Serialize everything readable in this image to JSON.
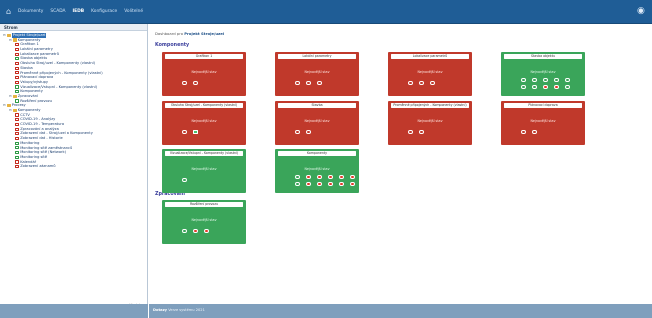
{
  "topbar": {
    "nav": [
      "Dokumenty",
      "SCADA",
      "IEDB",
      "Konfigurace",
      "Volitelné"
    ],
    "active_index": 2,
    "brand_color": "#1f5d96"
  },
  "left": {
    "title": "Strom",
    "tree": [
      {
        "label": "Projekt Stroje/uzel",
        "level": 0,
        "icon": "folder",
        "toggle": "-",
        "sel": true
      },
      {
        "label": "Komponenty",
        "level": 1,
        "icon": "folder",
        "toggle": "-"
      },
      {
        "label": "Grafikon 1",
        "level": 2,
        "icon": "red"
      },
      {
        "label": "Lokální parametry",
        "level": 2,
        "icon": "red"
      },
      {
        "label": "Lokalizace parametrů",
        "level": 2,
        "icon": "red"
      },
      {
        "label": "Stavba objektu",
        "level": 2,
        "icon": "green"
      },
      {
        "label": "Obsluha Stroj/uzel - Komponenty (vlastní)",
        "level": 2,
        "icon": "red"
      },
      {
        "label": "Stavba",
        "level": 2,
        "icon": "red"
      },
      {
        "label": "Proměnné připojených - Komponenty (vlastní)",
        "level": 2,
        "icon": "red"
      },
      {
        "label": "Plánovací doprava",
        "level": 2,
        "icon": "red"
      },
      {
        "label": "Vstupy/výstupy",
        "level": 2,
        "icon": "red"
      },
      {
        "label": "Vizualizace/Vstupní - Komponenty (vlastní)",
        "level": 2,
        "icon": "green"
      },
      {
        "label": "Komponenty",
        "level": 2,
        "icon": "green"
      },
      {
        "label": "Zpracování",
        "level": 1,
        "icon": "folder",
        "toggle": "-"
      },
      {
        "label": "Rozšíření provozu",
        "level": 2,
        "icon": "green"
      },
      {
        "label": "Procesy",
        "level": 0,
        "icon": "folder",
        "toggle": "-"
      },
      {
        "label": "Komponenty",
        "level": 1,
        "icon": "folder",
        "toggle": "-"
      },
      {
        "label": "CCTV",
        "level": 2,
        "icon": "red"
      },
      {
        "label": "COVID-19 - Analýzy",
        "level": 2,
        "icon": "red"
      },
      {
        "label": "COVID-19 - Temperatura",
        "level": 2,
        "icon": "red"
      },
      {
        "label": "Zpracování a analýza",
        "level": 2,
        "icon": "red"
      },
      {
        "label": "Zobrazení dat - Stroj/uzel a Komponenty",
        "level": 2,
        "icon": "red"
      },
      {
        "label": "Zobrazení dat - Historie",
        "level": 2,
        "icon": "red"
      },
      {
        "label": "Monitoring",
        "level": 2,
        "icon": "green"
      },
      {
        "label": "Monitoring sítě zaměstnanců",
        "level": 2,
        "icon": "green"
      },
      {
        "label": "Monitoring sítě (Network)",
        "level": 2,
        "icon": "green"
      },
      {
        "label": "Monitoring sítě",
        "level": 2,
        "icon": "green"
      },
      {
        "label": "Kalendář",
        "level": 2,
        "icon": "red"
      },
      {
        "label": "Zobrazení záznamů",
        "level": 2,
        "icon": "red"
      }
    ],
    "search": {
      "placeholder": "",
      "button": "Hledat"
    }
  },
  "main": {
    "breadcrumb_prefix": "Dashboard pro",
    "breadcrumb_target": "Projekt Stroje/uzel",
    "section_components": "Komponenty",
    "section_processing": "Zpracování",
    "card_subtitle": "Nejnovější stav"
  },
  "cards": [
    {
      "title": "Grafikon 1",
      "color": "red",
      "indicators": [
        "o",
        "o"
      ]
    },
    {
      "title": "Lokální parametry",
      "color": "red",
      "indicators": [
        "o",
        "o",
        "o"
      ]
    },
    {
      "title": "Lokalizace parametrů",
      "color": "red",
      "indicators": [
        "o",
        "o",
        "o"
      ]
    },
    {
      "title": "Stavba objektu",
      "color": "green",
      "indicators": [
        "o",
        "o",
        "o",
        "o",
        "o",
        "o",
        "o",
        "r",
        "r",
        "o"
      ]
    },
    {
      "title": "Obsluha Stroj/uzel - Komponenty (vlastní)",
      "color": "red",
      "indicators": [
        "o",
        "g"
      ]
    },
    {
      "title": "Stavba",
      "color": "red",
      "indicators": [
        "o",
        "o"
      ]
    },
    {
      "title": "Proměnné připojených - Komponenty (vlastní)",
      "color": "red",
      "indicators": [
        "o",
        "o"
      ]
    },
    {
      "title": "Plánovací doprava",
      "color": "red",
      "indicators": [
        "o",
        "o"
      ]
    },
    {
      "title": "Vizualizace/Vstupní - Komponenty (vlastní)",
      "color": "green",
      "indicators": [
        "o"
      ]
    },
    {
      "title": "Komponenty",
      "color": "green",
      "indicators": [
        "o",
        "r",
        "r",
        "r",
        "r",
        "r",
        "o",
        "r",
        "r",
        "r",
        "r",
        "r"
      ]
    },
    {
      "title": "Rozšíření provozu",
      "color": "green",
      "indicators": [
        "o",
        "r",
        "r"
      ]
    }
  ],
  "bottombar": {
    "label": "Dotazy",
    "text": "Verze systému 2021"
  }
}
